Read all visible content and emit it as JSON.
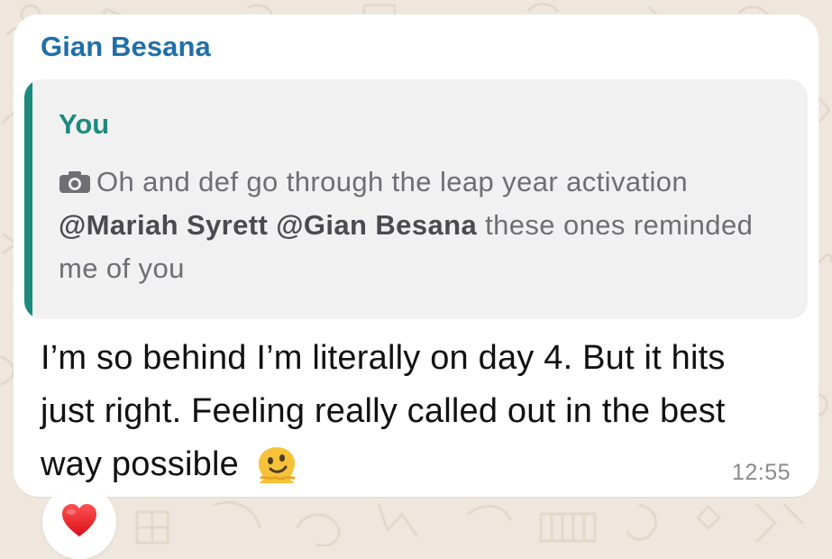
{
  "message": {
    "sender": "Gian Besana",
    "quoted": {
      "author": "You",
      "icon": "camera-icon",
      "text_before": "Oh and def go through the leap year activation ",
      "mention_1": "@Mariah Syrett",
      "between_mentions": " ",
      "mention_2": "@Gian Besana",
      "text_after": " these ones reminded me of you"
    },
    "text": "I’m so behind I’m literally on day 4. But it hits just right. Feeling really called out in the best way possible",
    "emoji": "melting-face-emoji",
    "time": "12:55"
  },
  "reaction": {
    "emoji": "red-heart-emoji"
  },
  "colors": {
    "sender": "#1f6fa8",
    "quote_accent": "#1b8a7d",
    "chat_background": "#efe7dd",
    "bubble": "#ffffff"
  }
}
